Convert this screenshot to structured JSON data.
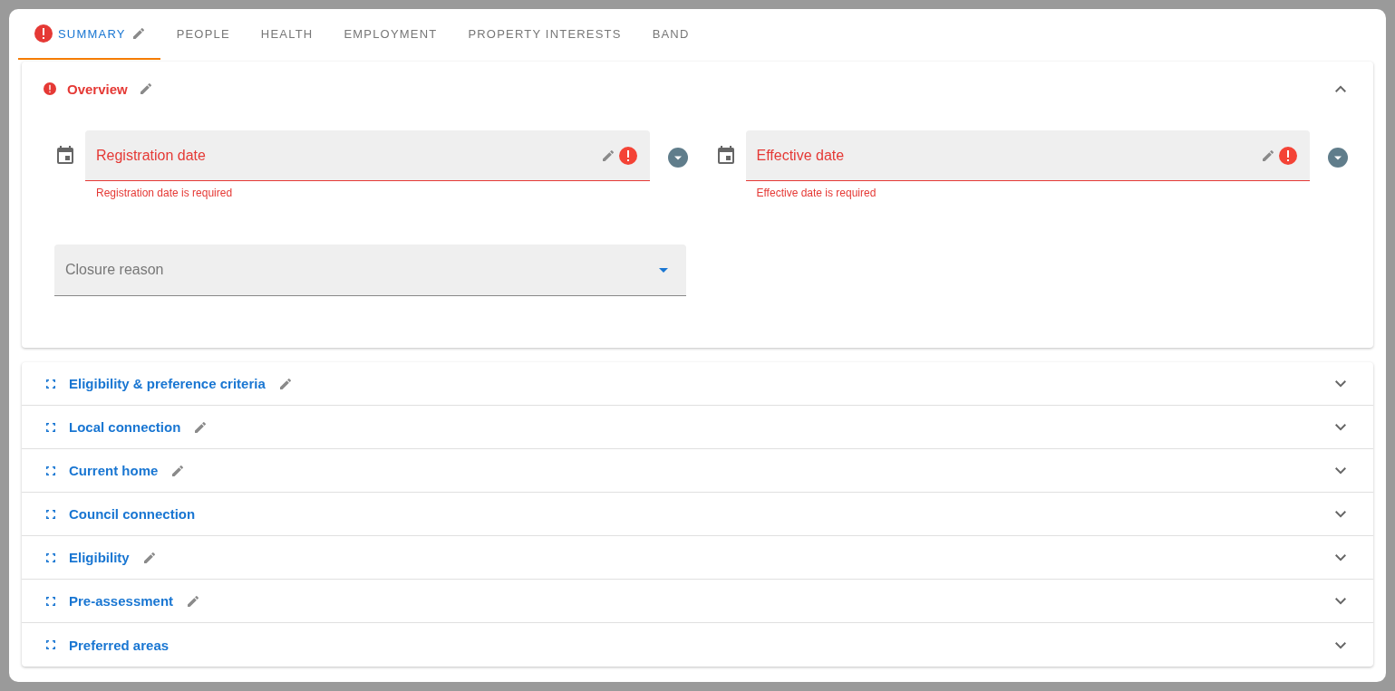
{
  "tabs": [
    {
      "label": "SUMMARY",
      "selected": true,
      "error": true,
      "editable": true
    },
    {
      "label": "PEOPLE",
      "selected": false,
      "error": false,
      "editable": false
    },
    {
      "label": "HEALTH",
      "selected": false,
      "error": false,
      "editable": false
    },
    {
      "label": "EMPLOYMENT",
      "selected": false,
      "error": false,
      "editable": false
    },
    {
      "label": "PROPERTY INTERESTS",
      "selected": false,
      "error": false,
      "editable": false
    },
    {
      "label": "BAND",
      "selected": false,
      "error": false,
      "editable": false
    }
  ],
  "overview": {
    "title": "Overview",
    "error": true,
    "editable": true,
    "expanded": true,
    "date_fields": [
      {
        "label": "Registration date",
        "error": true,
        "message": "Registration date is required"
      },
      {
        "label": "Effective date",
        "error": true,
        "message": "Effective date is required"
      }
    ],
    "select": {
      "placeholder": "Closure reason"
    }
  },
  "sections": [
    {
      "title": "Eligibility & preference criteria",
      "editable": true,
      "expanded": false
    },
    {
      "title": "Local connection",
      "editable": true,
      "expanded": false
    },
    {
      "title": "Current home",
      "editable": true,
      "expanded": false
    },
    {
      "title": "Council connection",
      "editable": false,
      "expanded": false
    },
    {
      "title": "Eligibility",
      "editable": true,
      "expanded": false
    },
    {
      "title": "Pre-assessment",
      "editable": true,
      "expanded": false
    },
    {
      "title": "Preferred areas",
      "editable": false,
      "expanded": false
    }
  ]
}
